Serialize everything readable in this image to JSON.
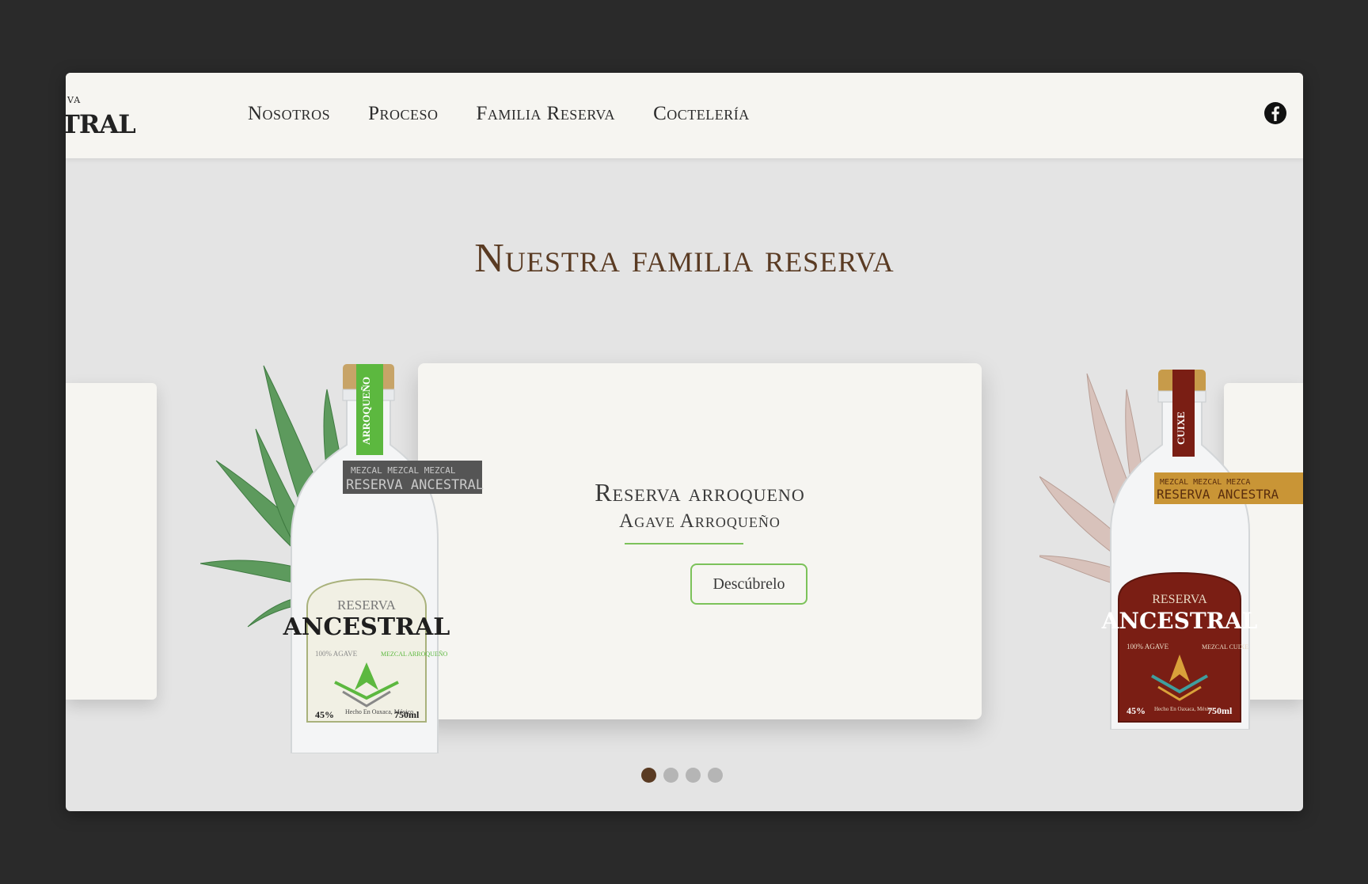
{
  "nav": {
    "logo_top": "VA",
    "logo_text": "TRAL",
    "links": [
      "Nosotros",
      "Proceso",
      "Familia Reserva",
      "Coctelería"
    ]
  },
  "section": {
    "title": "Nuestra familia reserva"
  },
  "slide": {
    "title": "Reserva arroqueno",
    "subtitle": "Agave Arroqueño",
    "button": "Descúbrelo"
  },
  "bottle_left": {
    "neck_band": "ARROQUEÑO",
    "strip_top": "MEZCAL   MEZCAL   MEZCAL",
    "strip_text": "RESERVA ANCESTRAL",
    "label_top": "RESERVA",
    "label_brand": "ANCESTRAL",
    "label_agave": "100% AGAVE",
    "label_mezcal": "MEZCAL ARROQUEÑO",
    "abv": "45%",
    "origin": "Hecho En Oaxaca, México",
    "volume": "750ml",
    "accent_color": "#5cb83f"
  },
  "bottle_right": {
    "neck_band": "CUIXE",
    "strip_top": "MEZCAL   MEZCAL   MEZCA",
    "strip_text": "RESERVA ANCESTRA",
    "label_top": "RESERVA",
    "label_brand": "ANCESTRAL",
    "label_agave": "100% AGAVE",
    "label_mezcal": "MEZCAL CUIXE",
    "abv": "45%",
    "origin": "Hecho En Oaxaca, México",
    "volume": "750ml",
    "accent_color": "#7a1e14"
  },
  "carousel": {
    "slide_count": 4,
    "active_index": 0
  },
  "colors": {
    "title_brown": "#5a3b23",
    "accent_green": "#7cc25a",
    "background": "#e4e4e4",
    "card": "#f6f5f1"
  },
  "icons": [
    "facebook-icon"
  ]
}
